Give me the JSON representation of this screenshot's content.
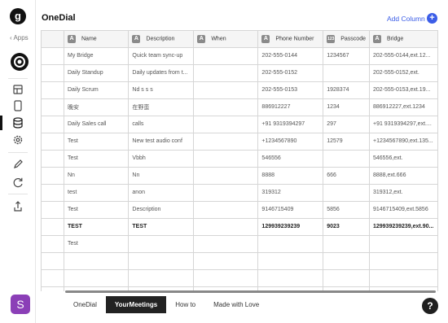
{
  "app": {
    "logo_letter": "g",
    "back_label": "‹ Apps",
    "avatar_letter": "S"
  },
  "doc": {
    "title": "OneDial",
    "add_column_label": "Add Column",
    "add_column_symbol": "+"
  },
  "columns": [
    {
      "label": "Name",
      "type_badge": "A"
    },
    {
      "label": "Description",
      "type_badge": "A"
    },
    {
      "label": "When",
      "type_badge": "A"
    },
    {
      "label": "Phone Number",
      "type_badge": "A"
    },
    {
      "label": "Passcode",
      "type_badge": "123"
    },
    {
      "label": "Bridge",
      "type_badge": "A"
    }
  ],
  "rows": [
    [
      "My Bridge",
      "Quick team sync-up",
      "",
      "202-555-0144",
      "1234567",
      "202-555-0144,ext.12..."
    ],
    [
      "Daily Standup",
      "Daily updates from t...",
      "",
      "202-555-0152",
      "",
      "202-555-0152,ext."
    ],
    [
      "Daily Scrum",
      "Nd s s s",
      "",
      "202-555-0153",
      "1928374",
      "202-555-0153,ext.19..."
    ],
    [
      "晚安",
      "在野蛮",
      "",
      "886912227",
      "1234",
      "886912227,ext.1234"
    ],
    [
      "Daily Sales call",
      "calls",
      "",
      "+91 9319394297",
      "297",
      "+91 9319394297,ext...."
    ],
    [
      "Test",
      "New test audio conf",
      "",
      "+1234567890",
      "12579",
      "+1234567890,ext.135..."
    ],
    [
      "Test",
      "Vbbh",
      "",
      "546556",
      "",
      "546556,ext."
    ],
    [
      "Nn",
      "Nn",
      "",
      "8888",
      "666",
      "8888,ext.666"
    ],
    [
      "test",
      "anon",
      "",
      "319312",
      "",
      "319312,ext."
    ],
    [
      "Test",
      "Description",
      "",
      "9146715409",
      "5856",
      "9146715409,ext.5856"
    ],
    [
      "TEST",
      "TEST",
      "",
      "129939239239",
      "9023",
      "129939239239,ext.90..."
    ],
    [
      "Test",
      "",
      "",
      "",
      "",
      ""
    ]
  ],
  "tabs": [
    {
      "label": "OneDial",
      "active": false
    },
    {
      "label": "YourMeetings",
      "active": true
    },
    {
      "label": "How to",
      "active": false
    },
    {
      "label": "Made with Love",
      "active": false
    }
  ],
  "help_label": "?",
  "icons": [
    "grist-logo",
    "document-icon",
    "raw-data-icon",
    "page-icon",
    "database-icon",
    "settings-icon",
    "pencil-icon",
    "refresh-icon",
    "share-icon",
    "help-icon"
  ]
}
